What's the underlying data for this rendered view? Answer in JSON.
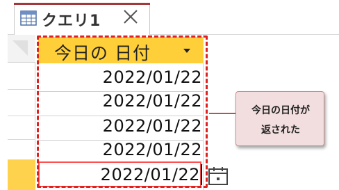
{
  "tab": {
    "label": "クエリ1"
  },
  "grid": {
    "column_header": "今日の 日付",
    "rows": [
      {
        "value": "2022/01/22"
      },
      {
        "value": "2022/01/22"
      },
      {
        "value": "2022/01/22"
      },
      {
        "value": "2022/01/22"
      }
    ],
    "edit_row": {
      "value": "2022/01/22"
    }
  },
  "callout": {
    "line1": "今日の日付が",
    "line2": "返された"
  },
  "colors": {
    "header": "#ffcf3a",
    "active_row_selector": "#ffd24d",
    "dashed_highlight": "#e0201f",
    "callout_bg": "#f2dede",
    "tab_accent": "#a4373a"
  },
  "icons": {
    "tab": "datasheet-icon",
    "close": "close-icon",
    "dropdown": "dropdown-arrow-icon",
    "calendar": "calendar-icon"
  }
}
